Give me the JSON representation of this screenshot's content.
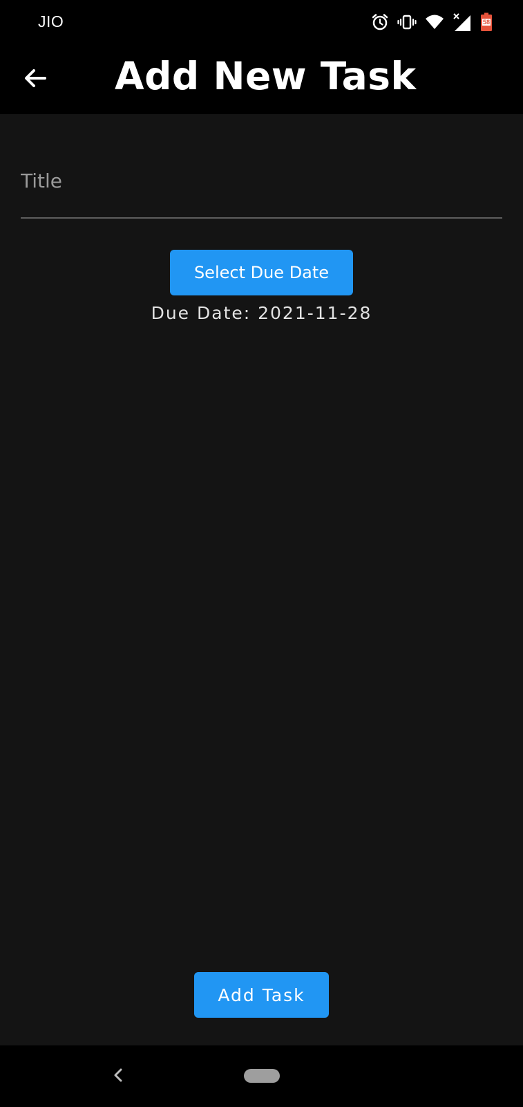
{
  "status_bar": {
    "carrier": "JIO",
    "icons": [
      "alarm-icon",
      "vibrate-icon",
      "wifi-icon",
      "signal-icon",
      "battery-icon"
    ],
    "battery_level": "58"
  },
  "app_bar": {
    "back_icon": "arrow-back-icon",
    "title": "Add New Task"
  },
  "form": {
    "title_placeholder": "Title",
    "title_value": "",
    "select_date_label": "Select Due Date",
    "due_date_text": "Due Date: 2021-11-28",
    "add_task_label": "Add Task"
  },
  "nav_bar": {
    "back_icon": "chevron-left-icon",
    "home_icon": "home-pill-icon"
  },
  "colors": {
    "background": "#141414",
    "bars": "#000000",
    "accent": "#2196f3",
    "battery": "#e5533b"
  }
}
